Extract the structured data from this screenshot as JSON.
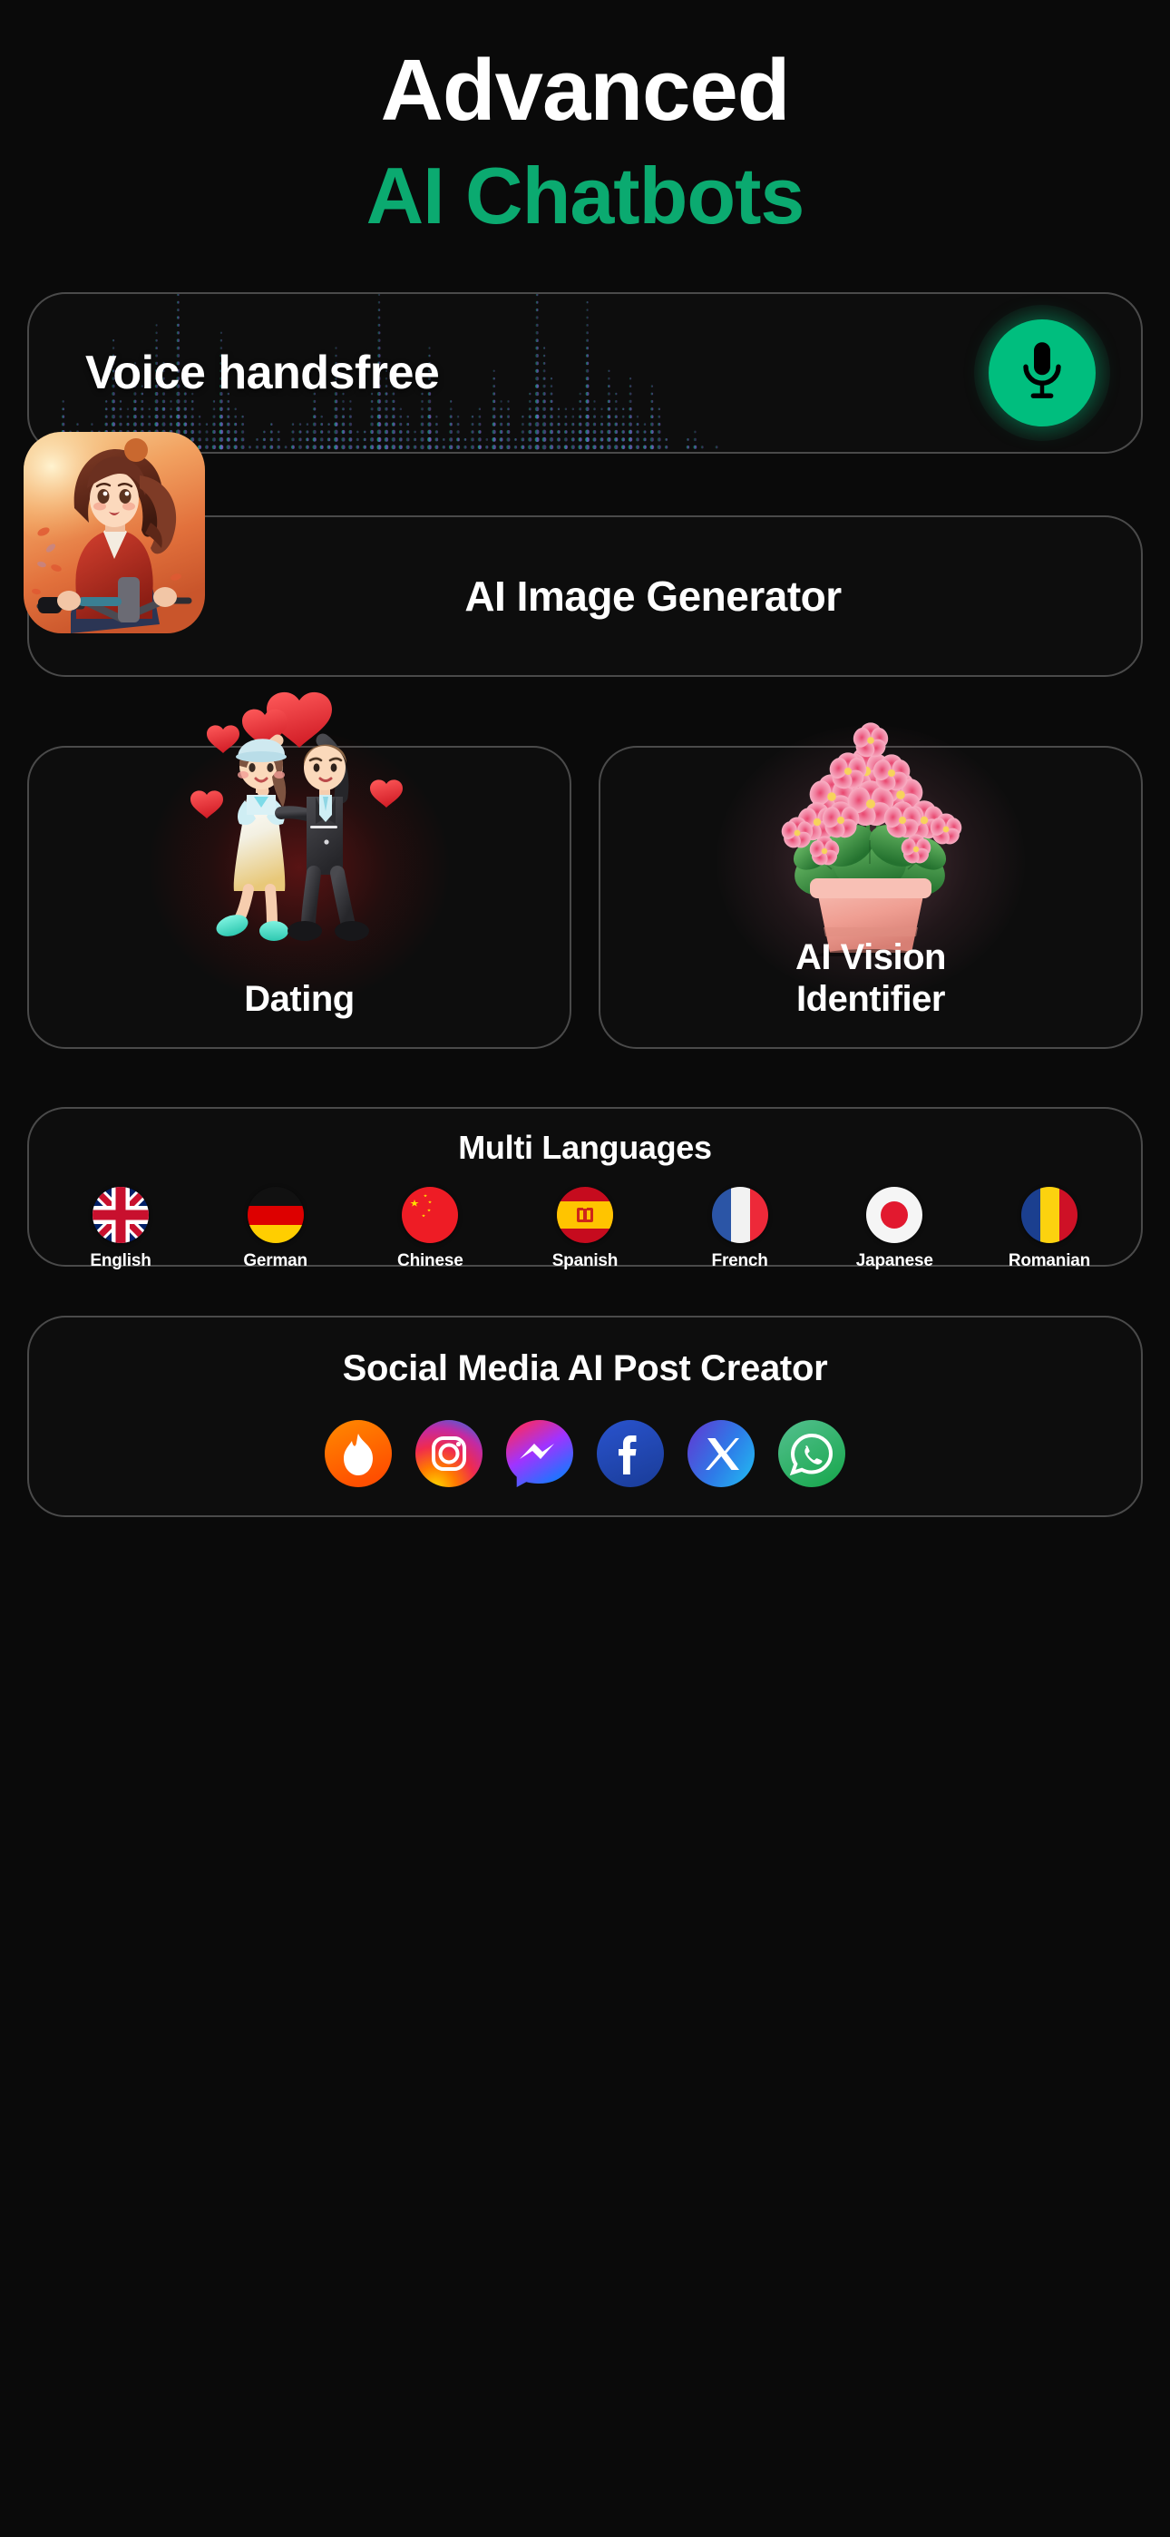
{
  "headline": {
    "line1": "Advanced",
    "line2": "AI Chatbots",
    "accent_color": "#0BAA70"
  },
  "voice": {
    "label": "Voice handsfree",
    "mic_icon": "microphone-icon",
    "button_color": "#00BE7E",
    "wave_colors": [
      "#18B37A",
      "#3F86C8",
      "#8B6BD8"
    ]
  },
  "image_generator": {
    "label": "AI Image Generator",
    "thumbnail": "anime-girl-on-bicycle-autumn-thumbnail"
  },
  "feature_cards": [
    {
      "label": "Dating",
      "art": "3d-couple-with-hearts-illustration",
      "glow": "#961919"
    },
    {
      "label": "AI Vision\nIdentifier",
      "label_line1": "AI Vision",
      "label_line2": "Identifier",
      "art": "pink-flowers-in-pot-photo",
      "glow": "#B46E82"
    }
  ],
  "languages": {
    "title": "Multi Languages",
    "items": [
      {
        "name": "English",
        "flag": "flag-united-kingdom"
      },
      {
        "name": "German",
        "flag": "flag-germany"
      },
      {
        "name": "Chinese",
        "flag": "flag-china"
      },
      {
        "name": "Spanish",
        "flag": "flag-spain"
      },
      {
        "name": "French",
        "flag": "flag-france"
      },
      {
        "name": "Japanese",
        "flag": "flag-japan"
      },
      {
        "name": "Romanian",
        "flag": "flag-romania"
      }
    ]
  },
  "social": {
    "title": "Social Media AI Post Creator",
    "items": [
      {
        "name": "tinder-icon",
        "color": "#FF6B00"
      },
      {
        "name": "instagram-icon",
        "color": "#E1306C"
      },
      {
        "name": "messenger-icon",
        "color": "#0084FF"
      },
      {
        "name": "facebook-icon",
        "color": "#1877F2"
      },
      {
        "name": "x-twitter-icon",
        "color": "#1DA1F2"
      },
      {
        "name": "whatsapp-icon",
        "color": "#25D366"
      }
    ]
  }
}
